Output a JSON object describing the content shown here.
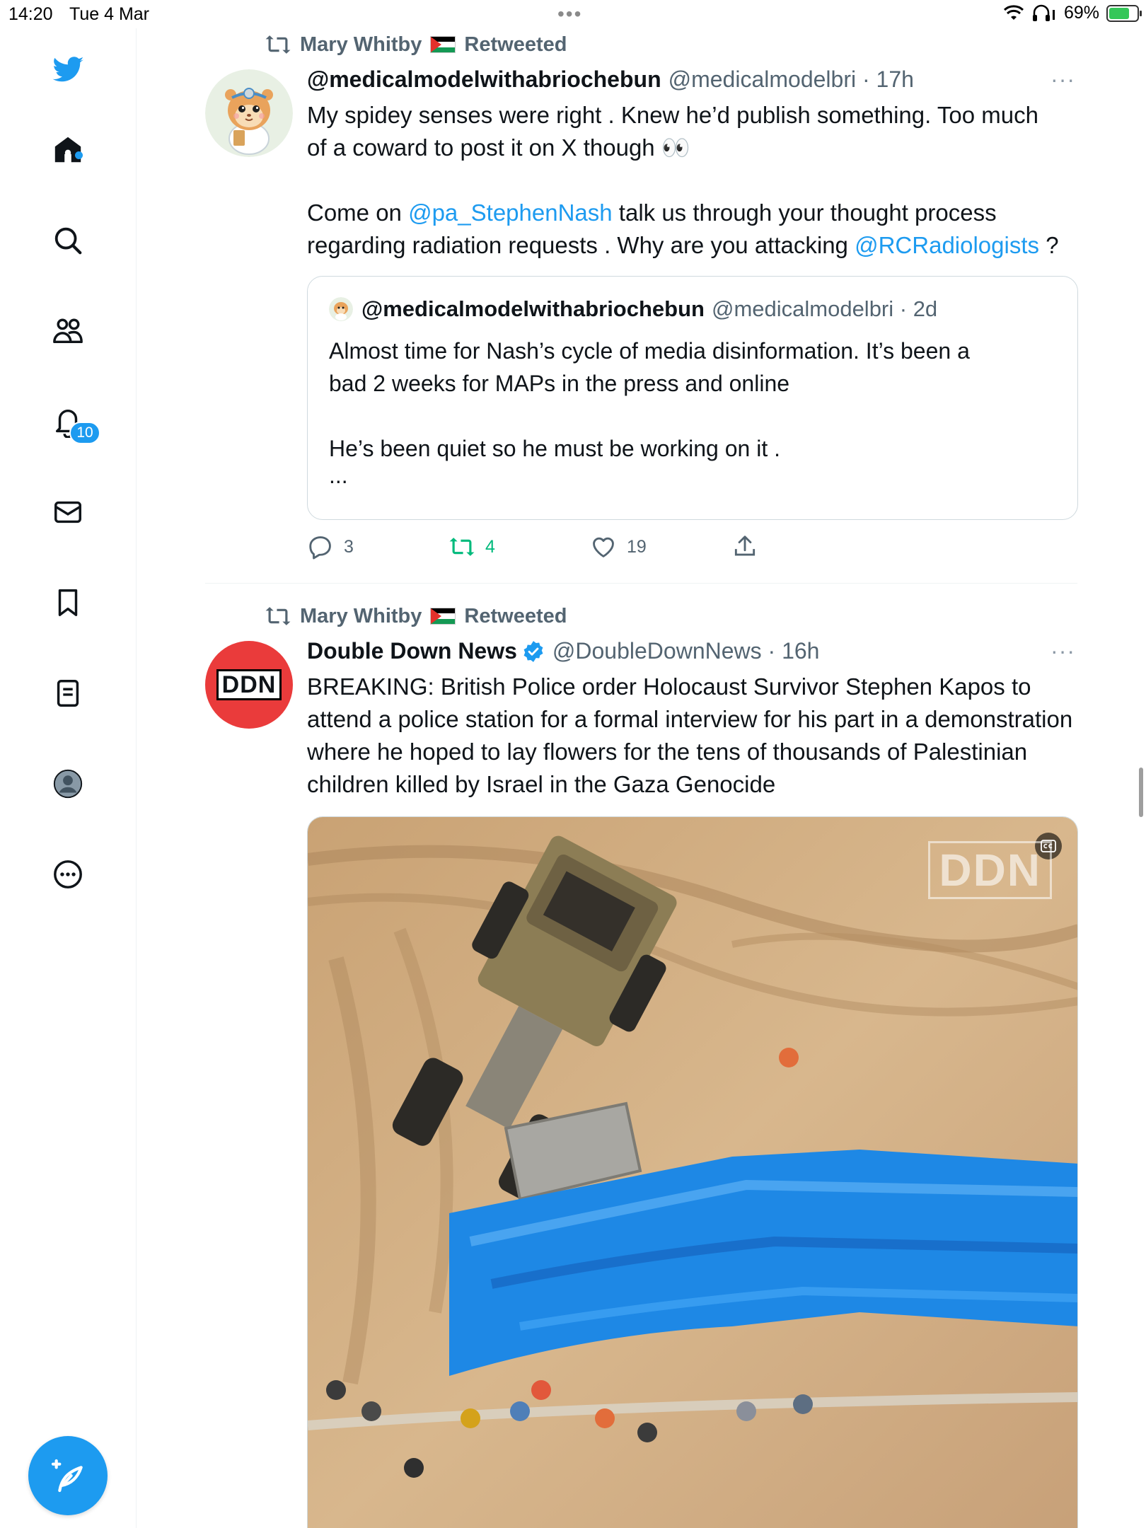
{
  "status_bar": {
    "time": "14:20",
    "date": "Tue 4 Mar",
    "battery": "69%",
    "battery_level": 0.69
  },
  "sidebar": {
    "items": [
      {
        "icon": "twitter-bird-icon"
      },
      {
        "icon": "home-icon"
      },
      {
        "icon": "search-icon"
      },
      {
        "icon": "communities-icon"
      },
      {
        "icon": "bell-icon"
      },
      {
        "icon": "mail-icon"
      },
      {
        "icon": "bookmark-icon"
      },
      {
        "icon": "lists-icon"
      },
      {
        "icon": "profile-icon"
      },
      {
        "icon": "more-icon"
      }
    ],
    "notification_count": "10",
    "accent": "#1d9bf0"
  },
  "tweets": [
    {
      "retweeted_by": "Mary Whitby",
      "retweeted_label": "Retweeted",
      "display_name": "@medicalmodelwithabriochebun",
      "handle_time": "@medicalmodelbri · 17h",
      "more": "···",
      "text_line1": "My spidey senses were right . Knew he’d publish something. Too much",
      "text_line2": "of a coward to post it on X though 👀",
      "text2_prefix": "Come on ",
      "mention1": "@pa_StephenNash",
      "text2_mid": " talk us through your thought process",
      "text3_prefix": "regarding radiation requests . Why are you attacking ",
      "mention2": "@RCRadiologists",
      "text3_suffix": " ?",
      "quote": {
        "display_name": "@medicalmodelwithabriochebun",
        "handle_time": "@medicalmodelbri · 2d",
        "line1": "Almost time for Nash’s cycle of media disinformation. It’s been a",
        "line2": "bad 2 weeks for MAPs in the press and online",
        "line3": "He’s been quiet so he must be working on it .",
        "line4": "..."
      },
      "replies": "3",
      "retweets": "4",
      "likes": "19"
    },
    {
      "retweeted_by": "Mary Whitby",
      "retweeted_label": "Retweeted",
      "display_name": "Double Down News",
      "handle_time": "@DoubleDownNews · 16h",
      "more": "···",
      "avatar_text": "DDN",
      "text": "BREAKING: British Police order Holocaust Survivor Stephen Kapos to attend a police station for a formal interview for his part in a demonstration where he hoped to lay flowers for the tens of thousands of Palestinian children killed by Israel in the Gaza Genocide",
      "media_watermark": "DDN",
      "media_caption_icon": "closed-captions-icon"
    }
  ]
}
